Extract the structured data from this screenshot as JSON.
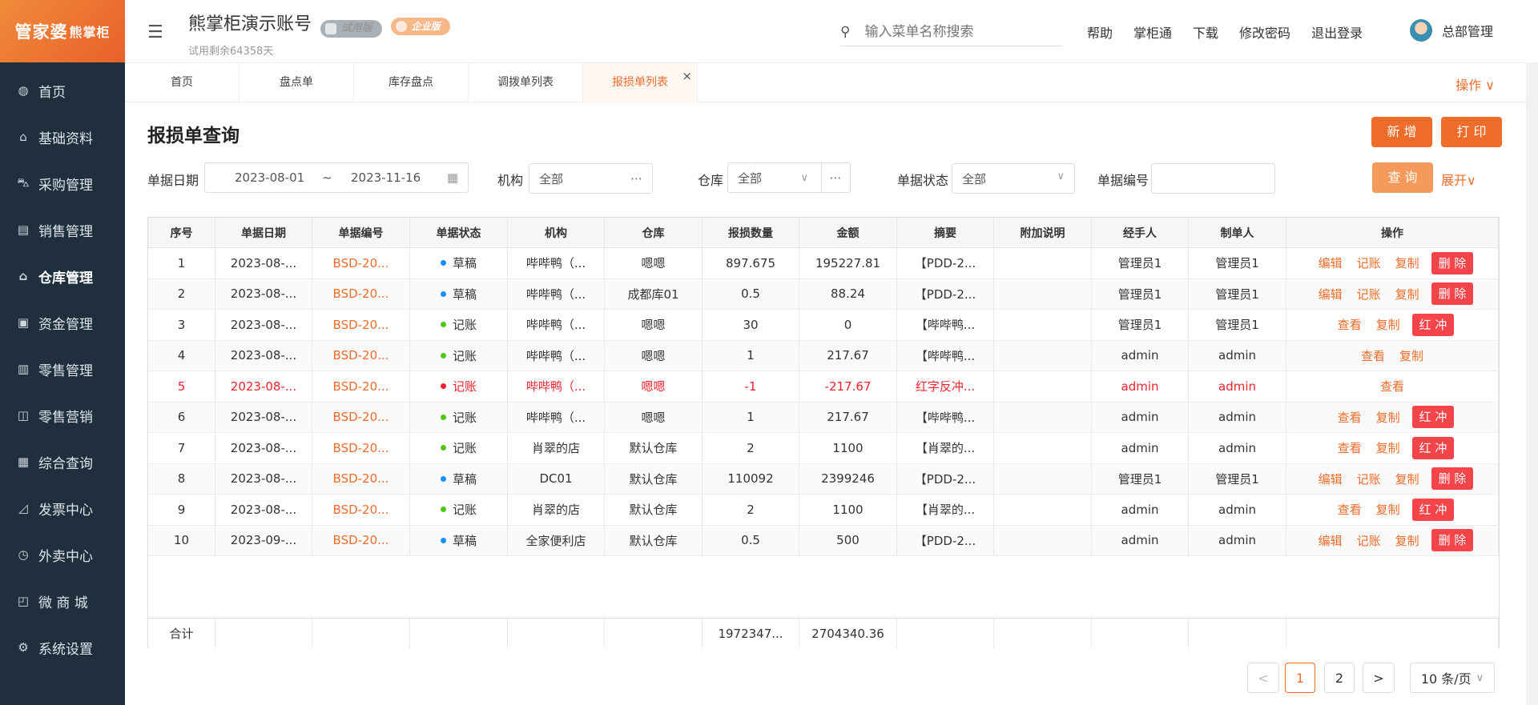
{
  "brand": {
    "logo_main": "管家婆",
    "logo_sub": "熊掌柜"
  },
  "sidebar": {
    "items": [
      {
        "label": "首页",
        "icon": "globe-icon"
      },
      {
        "label": "基础资料",
        "icon": "home-icon"
      },
      {
        "label": "采购管理",
        "icon": "cart-icon"
      },
      {
        "label": "销售管理",
        "icon": "calendar-icon"
      },
      {
        "label": "仓库管理",
        "icon": "warehouse-icon"
      },
      {
        "label": "资金管理",
        "icon": "fund-icon"
      },
      {
        "label": "零售管理",
        "icon": "chart-icon"
      },
      {
        "label": "零售营销",
        "icon": "gift-icon"
      },
      {
        "label": "综合查询",
        "icon": "bar-chart-icon"
      },
      {
        "label": "发票中心",
        "icon": "line-chart-icon"
      },
      {
        "label": "外卖中心",
        "icon": "delivery-icon"
      },
      {
        "label": "微 商 城",
        "icon": "bag-icon"
      },
      {
        "label": "系统设置",
        "icon": "gear-icon"
      }
    ]
  },
  "header": {
    "account_name": "熊掌柜演示账号",
    "trial_badge": "试用版",
    "ent_badge": "企业版",
    "trial_remaining": "试用剩余64358天",
    "search_placeholder": "输入菜单名称搜索",
    "links": [
      "帮助",
      "掌柜通",
      "下载",
      "修改密码",
      "退出登录"
    ],
    "user_name": "总部管理"
  },
  "tabs": {
    "items": [
      "首页",
      "盘点单",
      "库存盘点",
      "调拨单列表",
      "报损单列表"
    ],
    "ops_label": "操作 ∨"
  },
  "page": {
    "title": "报损单查询",
    "add_label": "新 增",
    "print_label": "打 印",
    "query_label": "查 询",
    "expand_label": "展开∨"
  },
  "filters": {
    "date_label": "单据日期",
    "date_from": "2023-08-01",
    "date_sep": "~",
    "date_to": "2023-11-16",
    "org_label": "机构",
    "org_value": "全部",
    "wh_label": "仓库",
    "wh_value": "全部",
    "status_label": "单据状态",
    "status_value": "全部",
    "code_label": "单据编号",
    "code_value": ""
  },
  "table": {
    "headers": [
      "序号",
      "单据日期",
      "单据编号",
      "单据状态",
      "机构",
      "仓库",
      "报损数量",
      "金额",
      "摘要",
      "附加说明",
      "经手人",
      "制单人",
      "操作"
    ],
    "rows": [
      {
        "no": "1",
        "date": "2023-08-...",
        "code": "BSD-20...",
        "status": "草稿",
        "dot": "blue",
        "org": "哔哔鸭（...",
        "wh": "嗯嗯",
        "qty": "897.675",
        "amt": "195227.81",
        "memo": "【PDD-2...",
        "note": "",
        "handler": "管理员1",
        "maker": "管理员1",
        "acts": [
          "编辑",
          "记账",
          "复制"
        ],
        "tag": "删 除",
        "red": false
      },
      {
        "no": "2",
        "date": "2023-08-...",
        "code": "BSD-20...",
        "status": "草稿",
        "dot": "blue",
        "org": "哔哔鸭（...",
        "wh": "成都库01",
        "qty": "0.5",
        "amt": "88.24",
        "memo": "【PDD-2...",
        "note": "",
        "handler": "管理员1",
        "maker": "管理员1",
        "acts": [
          "编辑",
          "记账",
          "复制"
        ],
        "tag": "删 除",
        "red": false
      },
      {
        "no": "3",
        "date": "2023-08-...",
        "code": "BSD-20...",
        "status": "记账",
        "dot": "green",
        "org": "哔哔鸭（...",
        "wh": "嗯嗯",
        "qty": "30",
        "amt": "0",
        "memo": "【哔哔鸭...",
        "note": "",
        "handler": "管理员1",
        "maker": "管理员1",
        "acts": [
          "查看",
          "复制"
        ],
        "tag": "红 冲",
        "red": false
      },
      {
        "no": "4",
        "date": "2023-08-...",
        "code": "BSD-20...",
        "status": "记账",
        "dot": "green",
        "org": "哔哔鸭（...",
        "wh": "嗯嗯",
        "qty": "1",
        "amt": "217.67",
        "memo": "【哔哔鸭...",
        "note": "",
        "handler": "admin",
        "maker": "admin",
        "acts": [
          "查看",
          "复制"
        ],
        "tag": "",
        "red": false
      },
      {
        "no": "5",
        "date": "2023-08-...",
        "code": "BSD-20...",
        "status": "记账",
        "dot": "red",
        "org": "哔哔鸭（...",
        "wh": "嗯嗯",
        "qty": "-1",
        "amt": "-217.67",
        "memo": "红字反冲...",
        "note": "",
        "handler": "admin",
        "maker": "admin",
        "acts": [
          "查看"
        ],
        "tag": "",
        "red": true
      },
      {
        "no": "6",
        "date": "2023-08-...",
        "code": "BSD-20...",
        "status": "记账",
        "dot": "green",
        "org": "哔哔鸭（...",
        "wh": "嗯嗯",
        "qty": "1",
        "amt": "217.67",
        "memo": "【哔哔鸭...",
        "note": "",
        "handler": "admin",
        "maker": "admin",
        "acts": [
          "查看",
          "复制"
        ],
        "tag": "红 冲",
        "red": false
      },
      {
        "no": "7",
        "date": "2023-08-...",
        "code": "BSD-20...",
        "status": "记账",
        "dot": "green",
        "org": "肖翠的店",
        "wh": "默认仓库",
        "qty": "2",
        "amt": "1100",
        "memo": "【肖翠的...",
        "note": "",
        "handler": "admin",
        "maker": "admin",
        "acts": [
          "查看",
          "复制"
        ],
        "tag": "红 冲",
        "red": false
      },
      {
        "no": "8",
        "date": "2023-08-...",
        "code": "BSD-20...",
        "status": "草稿",
        "dot": "blue",
        "org": "DC01",
        "wh": "默认仓库",
        "qty": "110092",
        "amt": "2399246",
        "memo": "【PDD-2...",
        "note": "",
        "handler": "管理员1",
        "maker": "管理员1",
        "acts": [
          "编辑",
          "记账",
          "复制"
        ],
        "tag": "删 除",
        "red": false
      },
      {
        "no": "9",
        "date": "2023-08-...",
        "code": "BSD-20...",
        "status": "记账",
        "dot": "green",
        "org": "肖翠的店",
        "wh": "默认仓库",
        "qty": "2",
        "amt": "1100",
        "memo": "【肖翠的...",
        "note": "",
        "handler": "admin",
        "maker": "admin",
        "acts": [
          "查看",
          "复制"
        ],
        "tag": "红 冲",
        "red": false
      },
      {
        "no": "10",
        "date": "2023-09-...",
        "code": "BSD-20...",
        "status": "草稿",
        "dot": "blue",
        "org": "全家便利店",
        "wh": "默认仓库",
        "qty": "0.5",
        "amt": "500",
        "memo": "【PDD-2...",
        "note": "",
        "handler": "admin",
        "maker": "admin",
        "acts": [
          "编辑",
          "记账",
          "复制"
        ],
        "tag": "删 除",
        "red": false
      }
    ],
    "footer": {
      "label": "合计",
      "qty": "1972347...",
      "amt": "2704340.36"
    }
  },
  "pagination": {
    "prev": "<",
    "pages": [
      "1",
      "2"
    ],
    "next": ">",
    "size": "10 条/页",
    "size_arrow": "∨"
  },
  "colors": {
    "accent": "#f06c2b",
    "sidebar": "#1f2f3d",
    "danger": "#f5454a"
  }
}
